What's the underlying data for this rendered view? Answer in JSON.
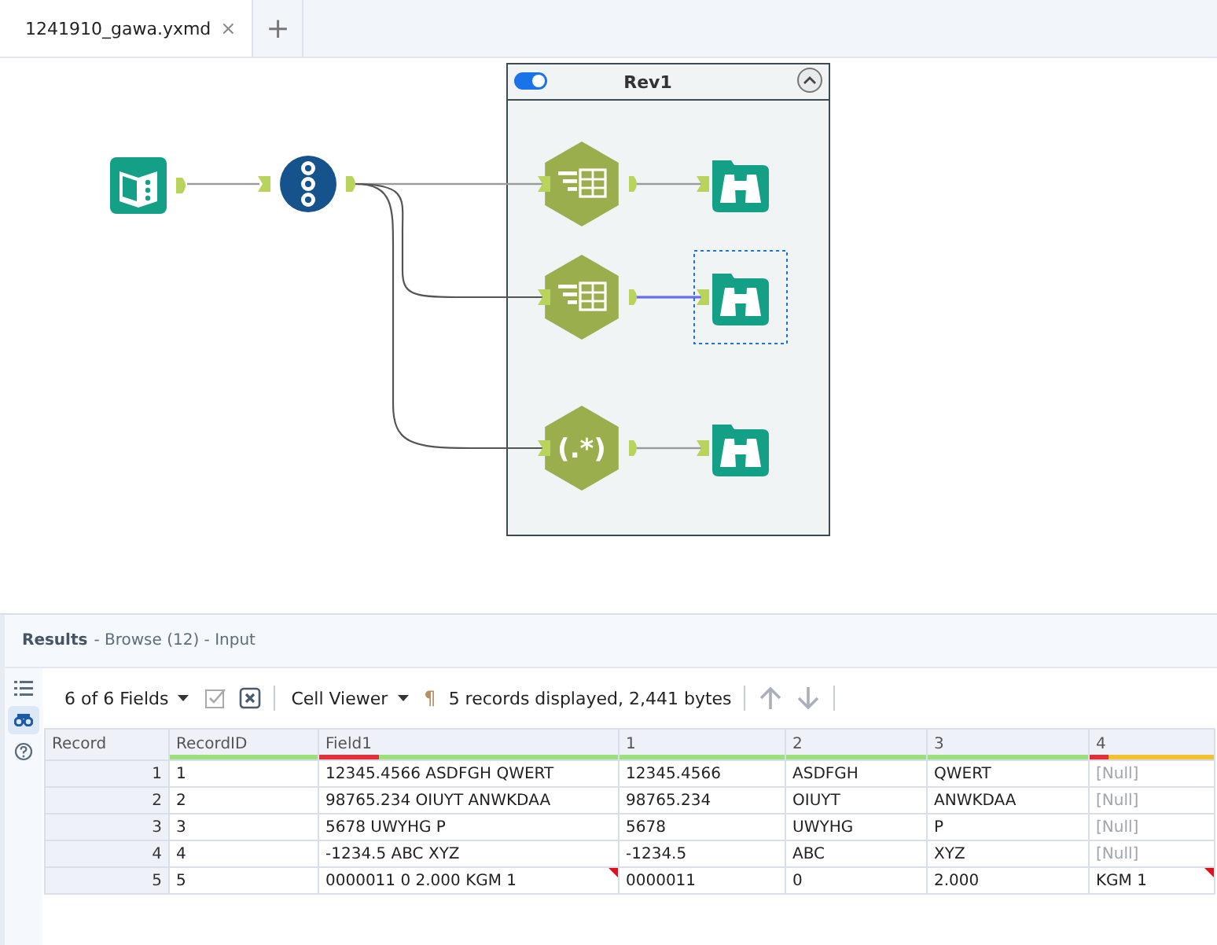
{
  "tabs": [
    {
      "label": "1241910_gawa.yxmd",
      "selected": true,
      "close": "×"
    }
  ],
  "add_tab": "+",
  "workflow": {
    "container": {
      "title": "Rev1",
      "enabled": true,
      "expanded": true
    },
    "nodes": [
      {
        "kind": "input",
        "selected": false
      },
      {
        "kind": "record_id",
        "selected": false
      },
      {
        "kind": "filter",
        "selected": false
      },
      {
        "kind": "filter",
        "selected": false
      },
      {
        "kind": "regex",
        "selected": false,
        "label": "(.*)"
      },
      {
        "kind": "browse",
        "selected": false
      },
      {
        "kind": "browse",
        "selected": true
      },
      {
        "kind": "browse",
        "selected": false
      }
    ],
    "connections": [
      {
        "selected": false
      },
      {
        "selected": false
      },
      {
        "selected": false
      },
      {
        "selected": false
      },
      {
        "selected": false
      },
      {
        "selected": true
      },
      {
        "selected": false
      }
    ]
  },
  "results": {
    "title": "Results",
    "subtitle": "- Browse (12) - Input",
    "side_tools": [
      {
        "kind": "list",
        "selected": false
      },
      {
        "kind": "browse",
        "selected": true
      },
      {
        "kind": "help",
        "selected": false
      }
    ],
    "fields_menu": "6 of 6 Fields",
    "cell_viewer": "Cell Viewer",
    "pilcrow": "¶",
    "summary": "5 records displayed, 2,441 bytes",
    "columns": [
      {
        "label": "Record",
        "kind": "index"
      },
      {
        "label": "RecordID",
        "kind": "ok"
      },
      {
        "label": "Field1",
        "kind": "truncated"
      },
      {
        "label": "1",
        "kind": "ok"
      },
      {
        "label": "2",
        "kind": "ok"
      },
      {
        "label": "3",
        "kind": "ok"
      },
      {
        "label": "4",
        "kind": "truncated_null"
      }
    ],
    "rows": [
      {
        "cells": [
          {
            "text": "1",
            "flag": false,
            "null": false
          },
          {
            "text": "1",
            "flag": false,
            "null": false
          },
          {
            "text": "12345.4566 ASDFGH QWERT",
            "flag": false,
            "null": false
          },
          {
            "text": "12345.4566",
            "flag": false,
            "null": false
          },
          {
            "text": "ASDFGH",
            "flag": false,
            "null": false
          },
          {
            "text": "QWERT",
            "flag": false,
            "null": false
          },
          {
            "text": "[Null]",
            "flag": false,
            "null": true
          }
        ]
      },
      {
        "cells": [
          {
            "text": "2",
            "flag": false,
            "null": false
          },
          {
            "text": "2",
            "flag": false,
            "null": false
          },
          {
            "text": "98765.234 OIUYT ANWKDAA",
            "flag": false,
            "null": false
          },
          {
            "text": "98765.234",
            "flag": false,
            "null": false
          },
          {
            "text": "OIUYT",
            "flag": false,
            "null": false
          },
          {
            "text": "ANWKDAA",
            "flag": false,
            "null": false
          },
          {
            "text": "[Null]",
            "flag": false,
            "null": true
          }
        ]
      },
      {
        "cells": [
          {
            "text": "3",
            "flag": false,
            "null": false
          },
          {
            "text": "3",
            "flag": false,
            "null": false
          },
          {
            "text": "5678 UWYHG P",
            "flag": false,
            "null": false
          },
          {
            "text": "5678",
            "flag": false,
            "null": false
          },
          {
            "text": "UWYHG",
            "flag": false,
            "null": false
          },
          {
            "text": "P",
            "flag": false,
            "null": false
          },
          {
            "text": "[Null]",
            "flag": false,
            "null": true
          }
        ]
      },
      {
        "cells": [
          {
            "text": "4",
            "flag": false,
            "null": false
          },
          {
            "text": "4",
            "flag": false,
            "null": false
          },
          {
            "text": "-1234.5 ABC XYZ",
            "flag": false,
            "null": false
          },
          {
            "text": "-1234.5",
            "flag": false,
            "null": false
          },
          {
            "text": "ABC",
            "flag": false,
            "null": false
          },
          {
            "text": "XYZ",
            "flag": false,
            "null": false
          },
          {
            "text": "[Null]",
            "flag": false,
            "null": true
          }
        ]
      },
      {
        "cells": [
          {
            "text": "5",
            "flag": false,
            "null": false
          },
          {
            "text": "5",
            "flag": false,
            "null": false
          },
          {
            "text": "0000011 0 2.000 KGM 1",
            "flag": true,
            "null": false
          },
          {
            "text": "0000011",
            "flag": false,
            "null": false
          },
          {
            "text": "0",
            "flag": false,
            "null": false
          },
          {
            "text": "2.000",
            "flag": false,
            "null": false
          },
          {
            "text": "KGM 1",
            "flag": true,
            "null": false
          }
        ]
      }
    ]
  }
}
